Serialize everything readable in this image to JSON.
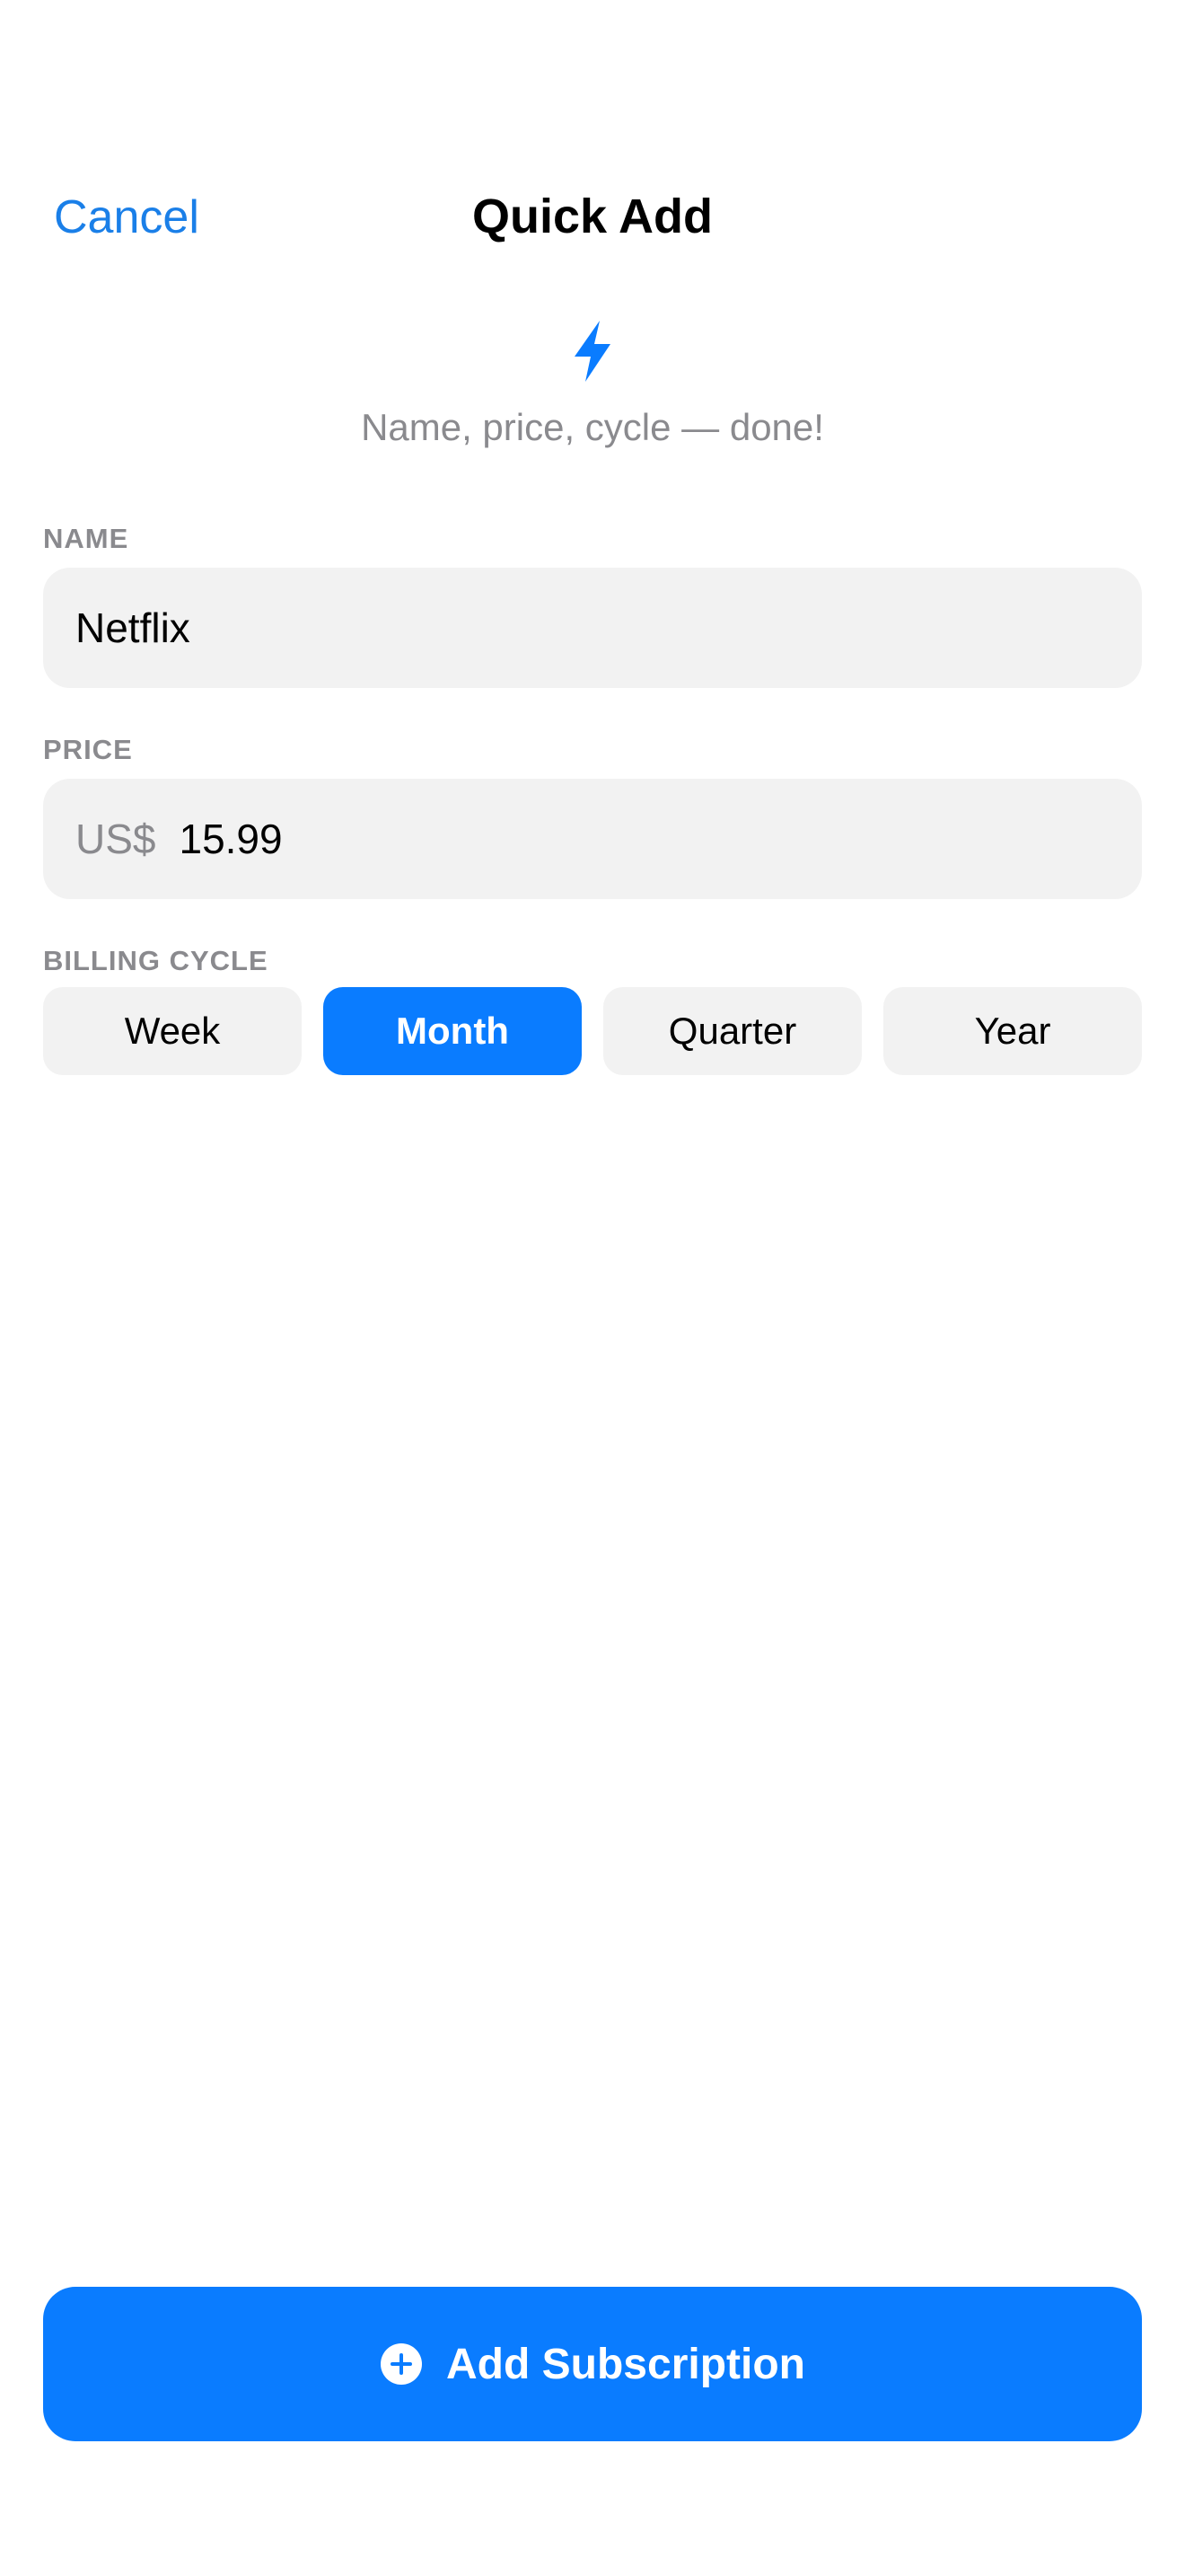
{
  "nav": {
    "cancel_label": "Cancel",
    "title": "Quick Add"
  },
  "hero": {
    "icon": "bolt-icon",
    "subtitle": "Name, price, cycle — done!"
  },
  "name_field": {
    "label": "NAME",
    "value": "Netflix"
  },
  "price_field": {
    "label": "PRICE",
    "currency": "US$",
    "value": "15.99"
  },
  "billing_cycle": {
    "label": "BILLING CYCLE",
    "options": [
      "Week",
      "Month",
      "Quarter",
      "Year"
    ],
    "selected": "Month"
  },
  "primary_action": {
    "icon": "plus-circle-icon",
    "label": "Add Subscription"
  },
  "colors": {
    "accent": "#0a7cff",
    "link": "#1a7fe8",
    "secondary_text": "#8a8a8e",
    "field_background": "#f2f2f2"
  }
}
